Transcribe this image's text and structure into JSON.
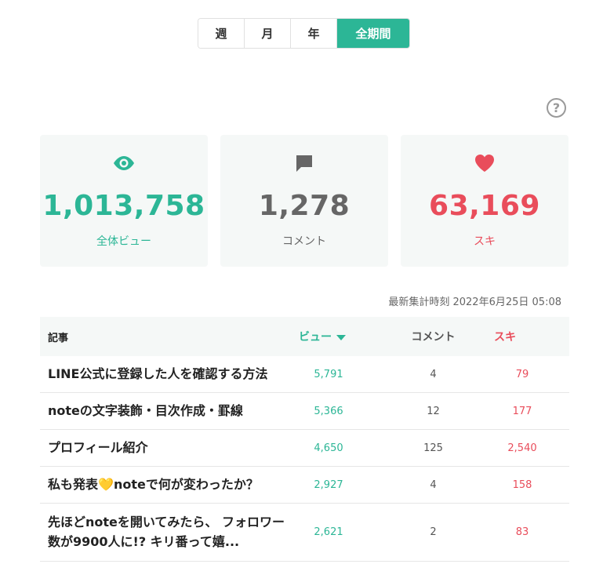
{
  "period_tabs": [
    {
      "label": "週",
      "active": false
    },
    {
      "label": "月",
      "active": false
    },
    {
      "label": "年",
      "active": false
    },
    {
      "label": "全期間",
      "active": true
    }
  ],
  "help": {
    "label": "?"
  },
  "stats": {
    "views": {
      "value": "1,013,758",
      "label": "全体ビュー",
      "icon": "eye-icon",
      "color": "#2cb696"
    },
    "comments": {
      "value": "1,278",
      "label": "コメント",
      "icon": "comment-icon",
      "color": "#666666"
    },
    "likes": {
      "value": "63,169",
      "label": "スキ",
      "icon": "heart-icon",
      "color": "#e94d5b"
    }
  },
  "updated_at": "最新集計時刻 2022年6月25日 05:08",
  "table": {
    "headers": {
      "title": "記事",
      "views": "ビュー",
      "comments": "コメント",
      "likes": "スキ"
    },
    "rows": [
      {
        "title": "LINE公式に登録した人を確認する方法",
        "views": "5,791",
        "comments": "4",
        "likes": "79"
      },
      {
        "title": "noteの文字装飾・目次作成・罫線",
        "views": "5,366",
        "comments": "12",
        "likes": "177"
      },
      {
        "title": "プロフィール紹介",
        "views": "4,650",
        "comments": "125",
        "likes": "2,540"
      },
      {
        "title_before": "私も発表",
        "title_heart": "💛",
        "title_after": "noteで何が変わったか？",
        "views": "2,927",
        "comments": "4",
        "likes": "158"
      },
      {
        "title": "先ほどnoteを開いてみたら、 フォロワー数が9900人に!? キリ番って嬉...",
        "views": "2,621",
        "comments": "2",
        "likes": "83"
      }
    ]
  }
}
